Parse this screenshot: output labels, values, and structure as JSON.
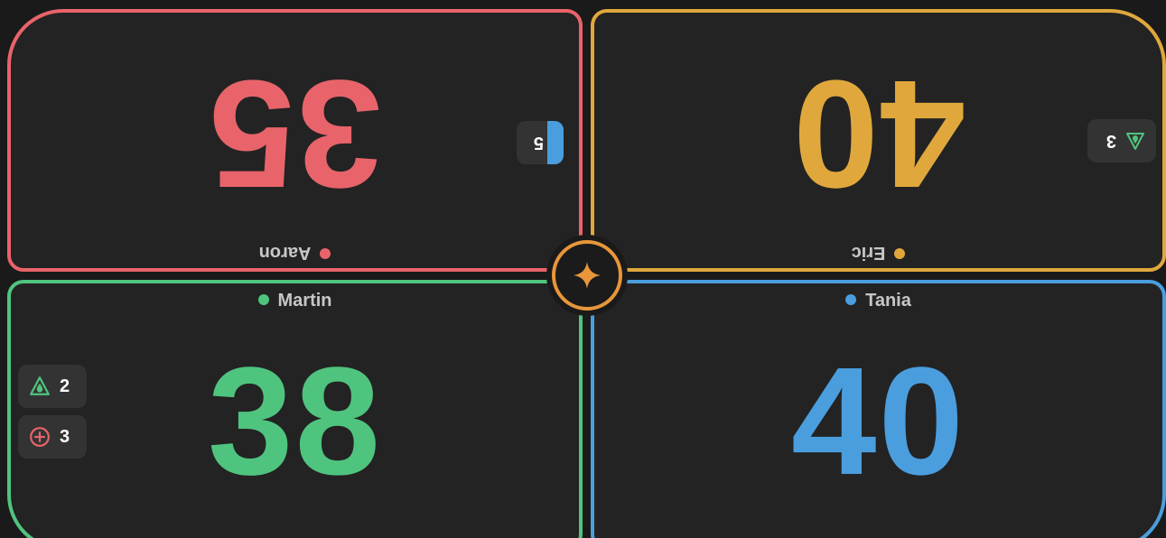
{
  "colors": {
    "aaron": "#e8646a",
    "eric": "#e0a83c",
    "martin": "#4fc47f",
    "tania": "#4a9ede",
    "center": "#e8963a"
  },
  "players": {
    "aaron": {
      "name": "Aaron",
      "life": "35",
      "commander_damage": "5"
    },
    "eric": {
      "name": "Eric",
      "life": "40",
      "poison": "3"
    },
    "martin": {
      "name": "Martin",
      "life": "38",
      "poison": "2",
      "energy": "3"
    },
    "tania": {
      "name": "Tania",
      "life": "40"
    }
  },
  "icons": {
    "poison": "droplet-triangle-icon",
    "energy": "plus-circle-icon",
    "menu": "sparkle-icon"
  }
}
